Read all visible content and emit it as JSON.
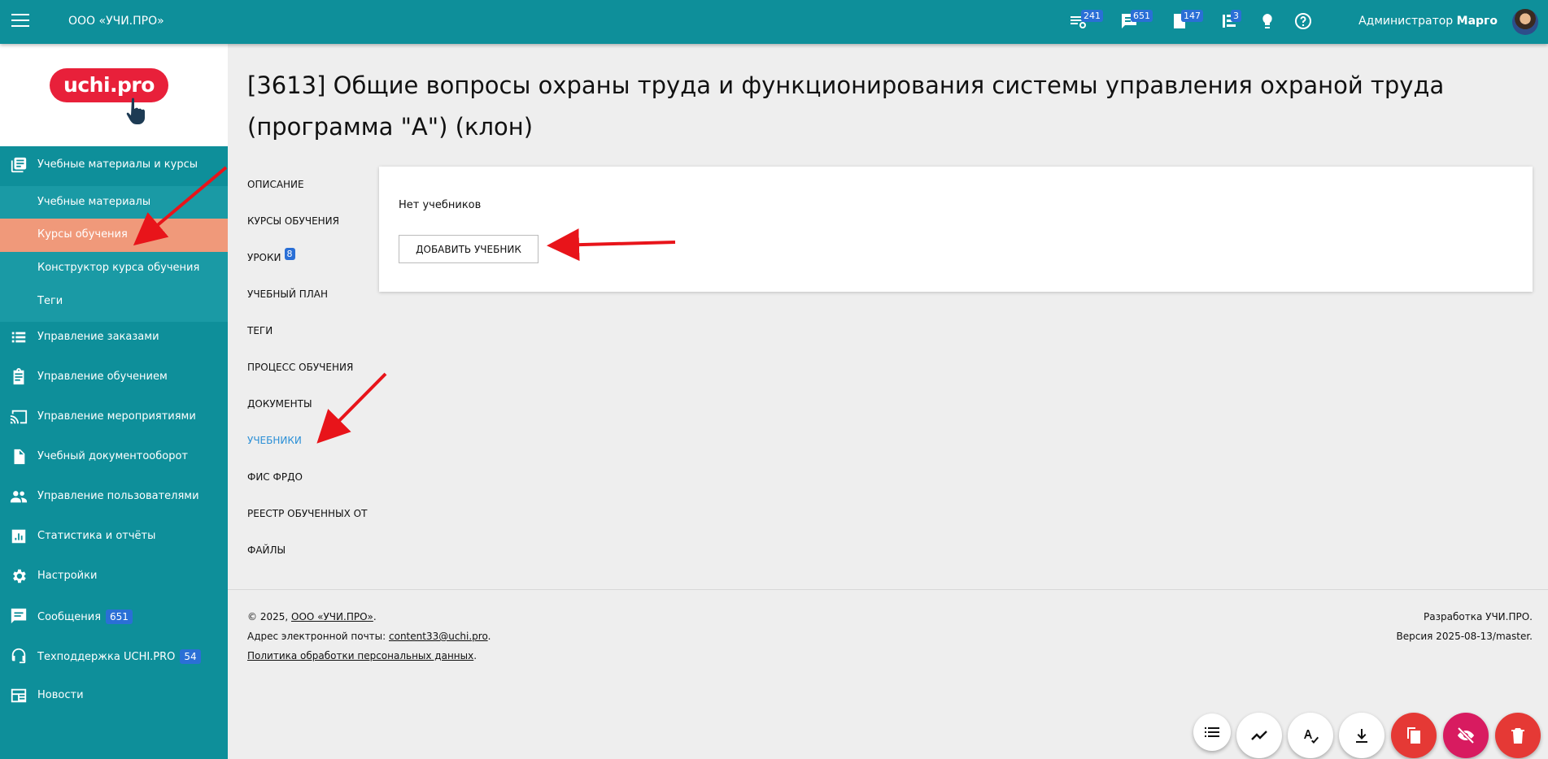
{
  "topbar": {
    "org_title": "ООО «УЧИ.ПРО»",
    "badges": [
      "241",
      "651",
      "147",
      "3"
    ],
    "admin_label": "Администратор",
    "admin_name": "Марго",
    "icons": [
      "menu-icon",
      "feed-icon",
      "chat-icon",
      "tasks-icon",
      "list-icon",
      "idea-icon",
      "help-icon"
    ]
  },
  "logo": {
    "text": "uchi.pro"
  },
  "sidebar": {
    "items": [
      {
        "label": "Учебные материалы и курсы",
        "icon": "book-icon"
      },
      {
        "label": "Управление заказами",
        "icon": "list-icon"
      },
      {
        "label": "Управление обучением",
        "icon": "clipboard-icon"
      },
      {
        "label": "Управление мероприятиями",
        "icon": "cast-icon"
      },
      {
        "label": "Учебный документооборот",
        "icon": "document-icon"
      },
      {
        "label": "Управление пользователями",
        "icon": "people-icon"
      },
      {
        "label": "Статистика и отчёты",
        "icon": "chart-icon"
      },
      {
        "label": "Настройки",
        "icon": "gear-icon"
      },
      {
        "label": "Сообщения",
        "icon": "message-icon",
        "badge": "651"
      },
      {
        "label": "Техподдержка UCHI.PRO",
        "icon": "support-icon",
        "badge": "54"
      },
      {
        "label": "Новости",
        "icon": "news-icon"
      }
    ],
    "subitems": [
      {
        "label": "Учебные материалы"
      },
      {
        "label": "Курсы обучения"
      },
      {
        "label": "Конструктор курса обучения"
      },
      {
        "label": "Теги"
      }
    ]
  },
  "main": {
    "title": "[3613] Общие вопросы охраны труда и функционирования системы управления охраной труда (программа \"А\") (клон)",
    "tabs": [
      {
        "label": "ОПИСАНИЕ"
      },
      {
        "label": "КУРСЫ ОБУЧЕНИЯ"
      },
      {
        "label": "УРОКИ",
        "badge": "8"
      },
      {
        "label": "УЧЕБНЫЙ ПЛАН"
      },
      {
        "label": "ТЕГИ"
      },
      {
        "label": "ПРОЦЕСС ОБУЧЕНИЯ"
      },
      {
        "label": "ДОКУМЕНТЫ"
      },
      {
        "label": "УЧЕБНИКИ"
      },
      {
        "label": "ФИС ФРДО"
      },
      {
        "label": "РЕЕСТР ОБУЧЕННЫХ ОТ"
      },
      {
        "label": "ФАЙЛЫ"
      }
    ],
    "active_tab": "УЧЕБНИКИ",
    "empty_text": "Нет учебников",
    "add_button": "ДОБАВИТЬ УЧЕБНИК"
  },
  "footer": {
    "copyright_prefix": "©  2025,",
    "company_link": "ООО «УЧИ.ПРО»",
    "dot": ".",
    "email_label": "Адрес электронной почты:",
    "email": "content33@uchi.pro",
    "privacy": "Политика обработки персональных данных",
    "dev": "Разработка УЧИ.ПРО.",
    "version": "Версия 2025-08-13/master."
  },
  "fabs": [
    "list-icon",
    "trend-icon",
    "spellcheck-icon",
    "download-icon",
    "copy-icon",
    "hide-icon",
    "delete-icon"
  ],
  "colors": {
    "teal": "#0e8f9a",
    "active_sub": "#f0997a",
    "badge": "#2a6fd6",
    "red": "#e53935",
    "pink": "#d81b60",
    "link": "#2a8fd6"
  }
}
